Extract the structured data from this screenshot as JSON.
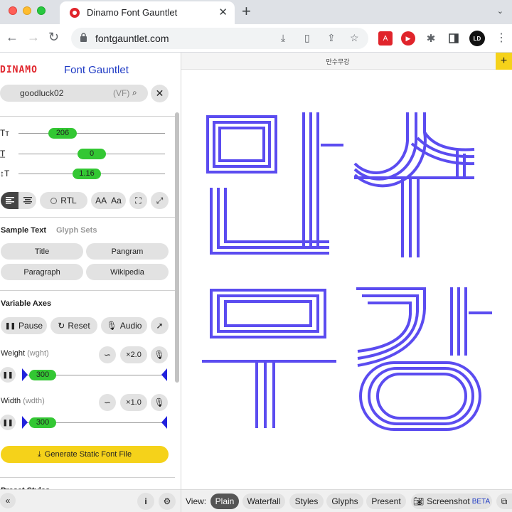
{
  "browser": {
    "tab_title": "Dinamo Font Gauntlet",
    "url": "fontgauntlet.com",
    "avatar_initials": "LD"
  },
  "sidebar": {
    "logo": "DINAMO",
    "app_name": "Font Gauntlet",
    "font_name": "goodluck02",
    "font_suffix": "(VF)",
    "sliders": [
      {
        "icon": "Tт",
        "value": "206",
        "fraction": 0.3
      },
      {
        "icon": "T̲",
        "value": "0",
        "fraction": 0.5
      },
      {
        "icon": "↕T",
        "value": "1.16",
        "fraction": 0.47
      }
    ],
    "rtl_label": "RTL",
    "case_upper": "AA",
    "case_mixed": "Aa",
    "sample_text_title": "Sample Text",
    "glyph_sets_title": "Glyph Sets",
    "sample_buttons": [
      "Title",
      "Pangram",
      "Paragraph",
      "Wikipedia"
    ],
    "variable_axes_title": "Variable Axes",
    "pause_label": "Pause",
    "reset_label": "Reset",
    "audio_label": "Audio",
    "axes": [
      {
        "name": "Weight",
        "tag": "(wght)",
        "multiplier": "×2.0",
        "value": "300"
      },
      {
        "name": "Width",
        "tag": "(wdth)",
        "multiplier": "×1.0",
        "value": "300"
      }
    ],
    "generate_label": "Generate Static Font File",
    "preset_title": "Preset Styles"
  },
  "main": {
    "preview_title": "만수무강",
    "view_label": "View:",
    "view_buttons": [
      "Plain",
      "Waterfall",
      "Styles",
      "Glyphs",
      "Present"
    ],
    "screenshot_label": "Screenshot",
    "beta_label": "BETA",
    "glyph_color": "#5b4cf0"
  },
  "colors": {
    "accent_green": "#33c733",
    "accent_yellow": "#f5d21a",
    "brand_red": "#e0242b",
    "brand_blue": "#1d39c4"
  }
}
